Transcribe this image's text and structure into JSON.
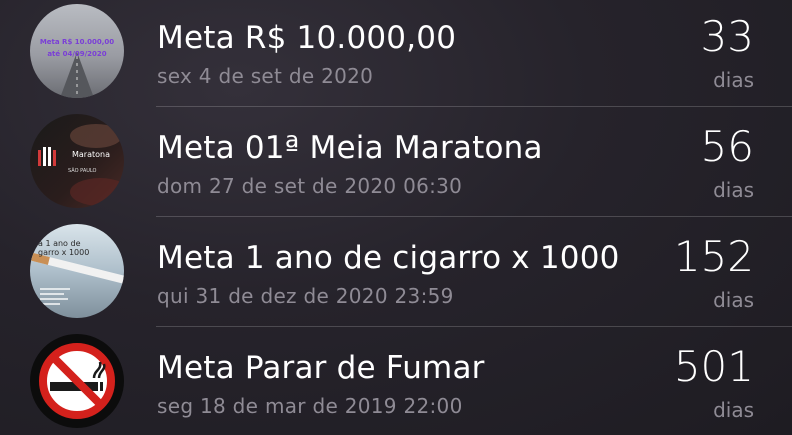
{
  "items": [
    {
      "thumb_icon": "road-goal-image",
      "thumb_text_1": "Meta R$ 10.000,00",
      "thumb_text_2": "até 04/09/2020",
      "title": "Meta R$ 10.000,00",
      "date": "sex 4 de set de 2020",
      "count": "33",
      "unit": "dias"
    },
    {
      "thumb_icon": "marathon-logo-image",
      "thumb_text_1": "Maratona",
      "thumb_text_2": "SÃO PAULO",
      "title": "Meta 01ª Meia Maratona",
      "date": "dom 27 de set de 2020 06:30",
      "count": "56",
      "unit": "dias"
    },
    {
      "thumb_icon": "cigarette-goal-image",
      "thumb_text_1": "a 1 ano de",
      "thumb_text_2": "garro x 1000",
      "title": "Meta 1 ano de cigarro x 1000",
      "date": "qui 31 de dez de 2020 23:59",
      "count": "152",
      "unit": "dias"
    },
    {
      "thumb_icon": "no-smoking-icon",
      "title": "Meta Parar de Fumar",
      "date": "seg 18 de mar de 2019 22:00",
      "count": "501",
      "unit": "dias"
    }
  ],
  "colors": {
    "background": "#26232b",
    "secondary_text": "#8f8b95",
    "no_smoking_red": "#d4211c",
    "thumb_purple_text": "#7a3fd6"
  }
}
